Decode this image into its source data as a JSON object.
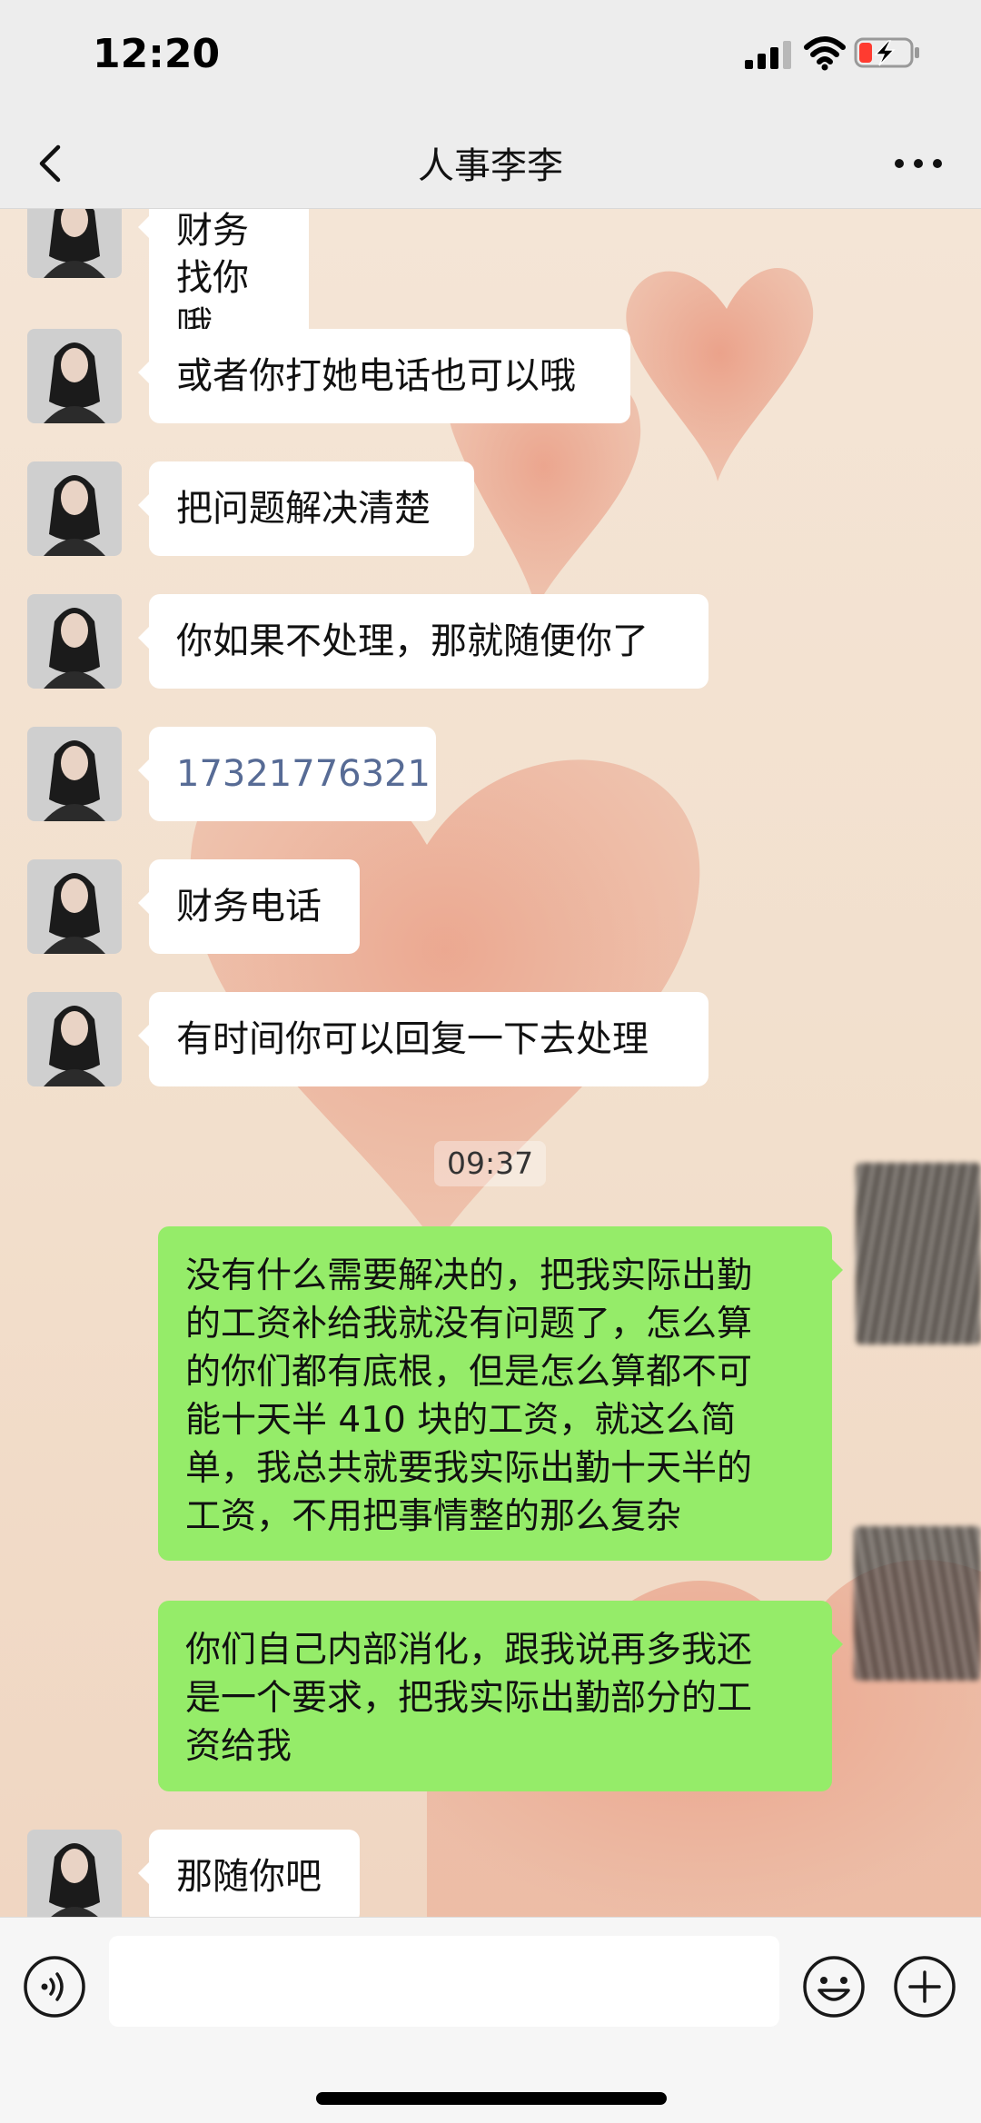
{
  "status_bar": {
    "time": "12:20"
  },
  "header": {
    "title": "人事李李"
  },
  "messages": [
    {
      "text": "财务找你哦"
    },
    {
      "text": "或者你打她电话也可以哦"
    },
    {
      "text": "把问题解决清楚"
    },
    {
      "text": "你如果不处理，那就随便你了"
    },
    {
      "text": "17321776321"
    },
    {
      "text": "财务电话"
    },
    {
      "text": "有时间你可以回复一下去处理"
    },
    {
      "time": "09:37"
    },
    {
      "lines": [
        "没有什么需要解决的，把我实际出勤",
        "的工资补给我就没有问题了，怎么算",
        "的你们都有底根，但是怎么算都不可",
        "能十天半 410 块的工资，就这么简",
        "单，我总共就要我实际出勤十天半的",
        "工资，不用把事情整的那么复杂"
      ]
    },
    {
      "lines": [
        "你们自己内部消化，跟我说再多我还",
        "是一个要求，把我实际出勤部分的工",
        "资给我"
      ]
    },
    {
      "text": "那随你吧"
    }
  ],
  "input": {
    "placeholder": ""
  },
  "colors": {
    "outgoing_bubble": "#95ec69",
    "incoming_bubble": "#ffffff",
    "link": "#576b95"
  },
  "icons": [
    "signal-icon",
    "wifi-icon",
    "battery-charging-icon",
    "back-icon",
    "more-icon",
    "voice-icon",
    "emoji-icon",
    "plus-icon"
  ]
}
